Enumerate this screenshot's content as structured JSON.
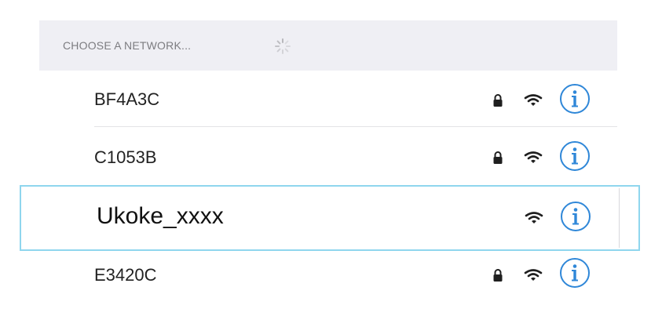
{
  "header": {
    "title": "CHOOSE A NETWORK...",
    "loading_icon": "spinner-icon"
  },
  "colors": {
    "header_bg": "#efeff4",
    "header_text": "#7c7c80",
    "accent": "#2f87d8",
    "highlight_border": "#8fd6ee",
    "separator": "#e3e3e6"
  },
  "networks": [
    {
      "ssid": "BF4A3C",
      "secured": true,
      "icons": [
        "lock-icon",
        "wifi-icon",
        "info-icon"
      ]
    },
    {
      "ssid": "C1053B",
      "secured": true,
      "icons": [
        "lock-icon",
        "wifi-icon",
        "info-icon"
      ]
    },
    {
      "ssid": "Ukoke_xxxx",
      "secured": false,
      "highlighted": true,
      "icons": [
        "wifi-icon",
        "info-icon"
      ]
    },
    {
      "ssid": "E3420C",
      "secured": true,
      "icons": [
        "lock-icon",
        "wifi-icon",
        "info-icon"
      ]
    }
  ]
}
